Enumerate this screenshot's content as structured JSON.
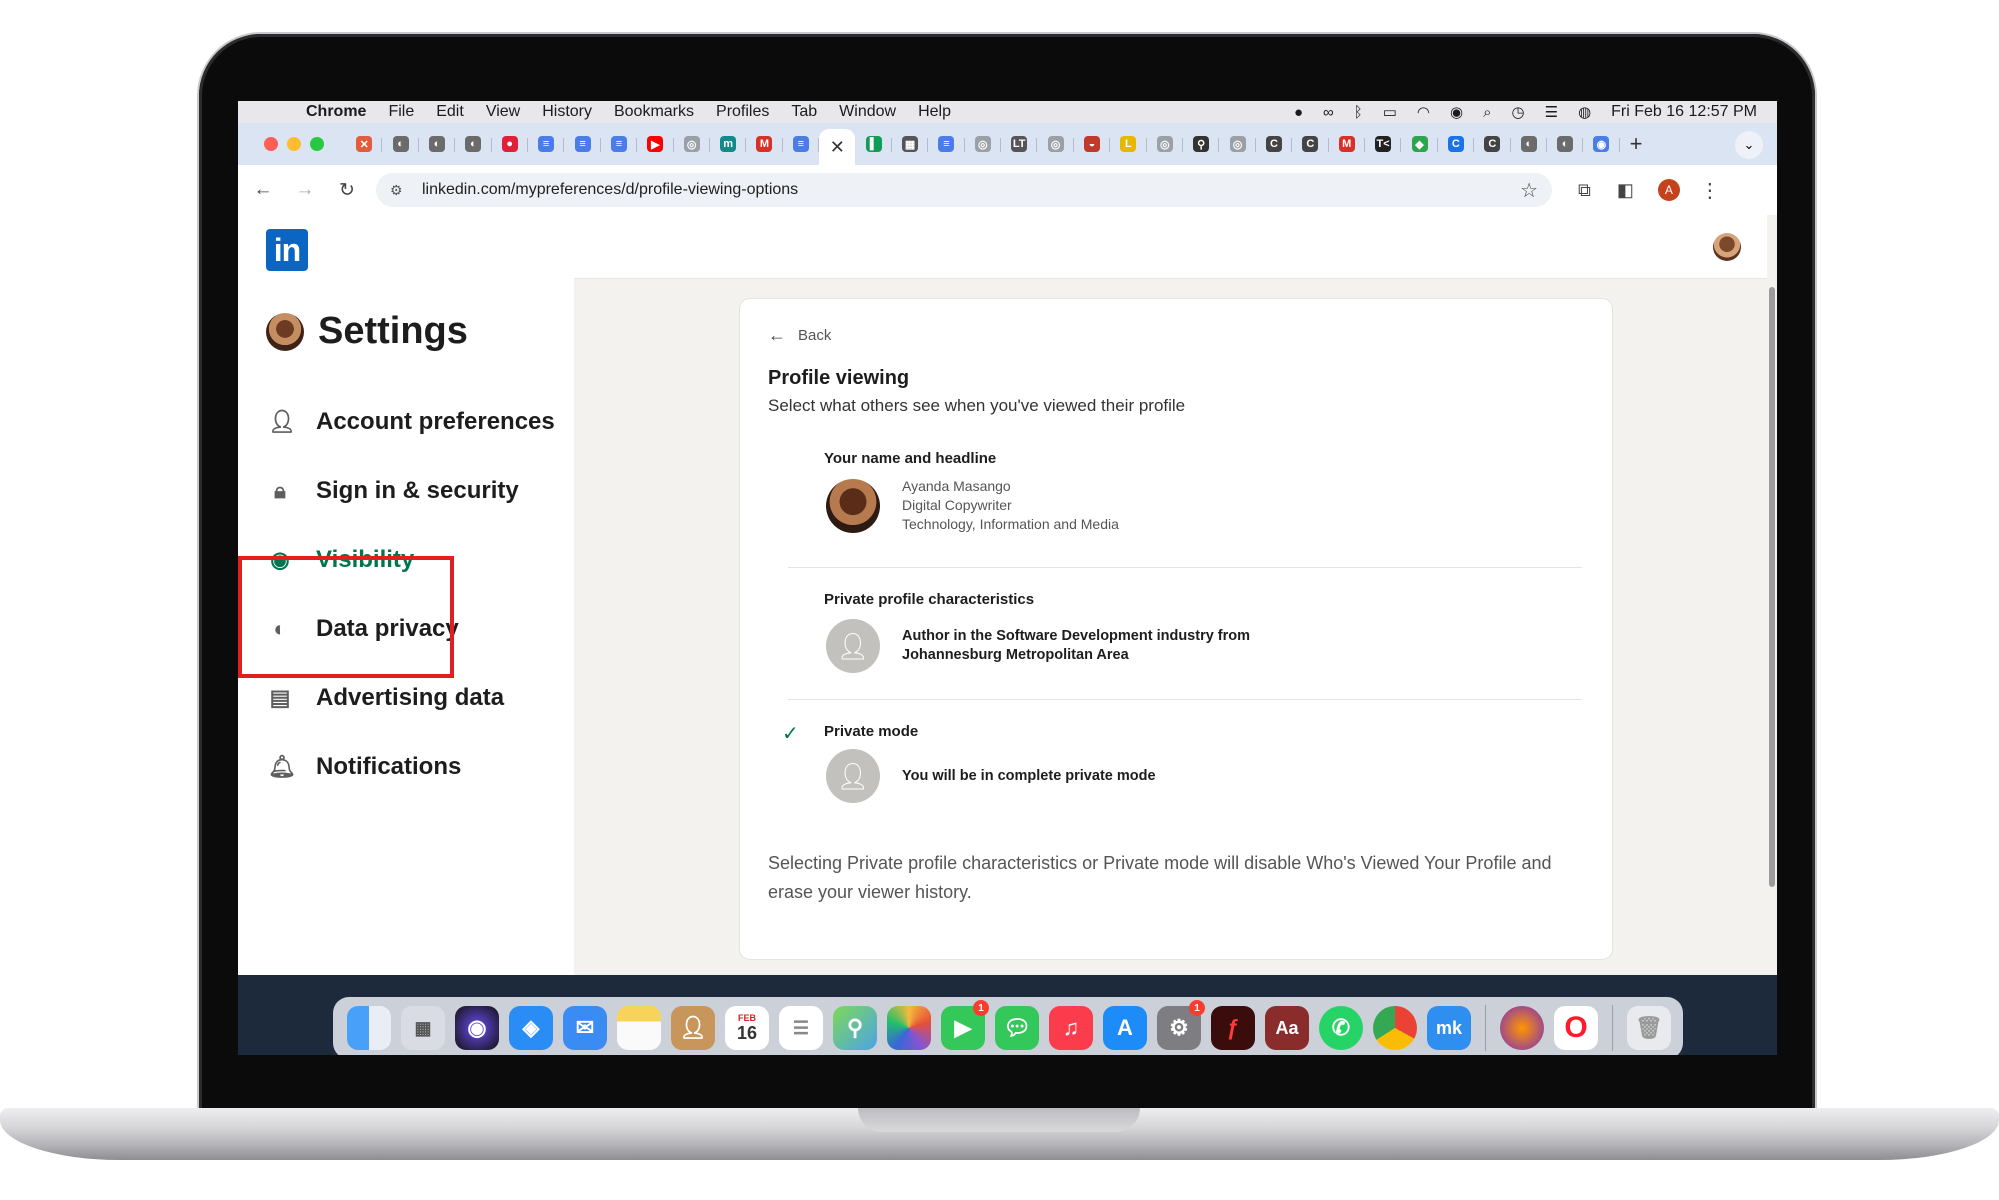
{
  "menubar": {
    "items": [
      "Chrome",
      "File",
      "Edit",
      "View",
      "History",
      "Bookmarks",
      "Profiles",
      "Tab",
      "Window",
      "Help"
    ],
    "clock": "Fri Feb 16  12:57 PM"
  },
  "browser": {
    "url": "linkedin.com/mypreferences/d/profile-viewing-options",
    "profile_initial": "A",
    "tab_favicons": [
      {
        "color": "#e05c3c",
        "glyph": "✕"
      },
      {
        "color": "#6b6b6b",
        "glyph": "◐"
      },
      {
        "color": "#6b6b6b",
        "glyph": "◐"
      },
      {
        "color": "#6b6b6b",
        "glyph": "◐"
      },
      {
        "color": "#e0203a",
        "glyph": "●"
      },
      {
        "color": "#4a7de8",
        "glyph": "≡"
      },
      {
        "color": "#4a7de8",
        "glyph": "≡"
      },
      {
        "color": "#4a7de8",
        "glyph": "≡"
      },
      {
        "color": "#ff0000",
        "glyph": "▶"
      },
      {
        "color": "#9aa0a6",
        "glyph": "◎"
      },
      {
        "color": "#138a8a",
        "glyph": "m"
      },
      {
        "color": "#d93025",
        "glyph": "M"
      },
      {
        "color": "#4a7de8",
        "glyph": "≡"
      }
    ],
    "tab_favicons_after": [
      {
        "color": "#0f9d58",
        "glyph": "▌"
      },
      {
        "color": "#555555",
        "glyph": "▦"
      },
      {
        "color": "#4a7de8",
        "glyph": "≡"
      },
      {
        "color": "#9aa0a6",
        "glyph": "◎"
      },
      {
        "color": "#555555",
        "glyph": "LT"
      },
      {
        "color": "#9aa0a6",
        "glyph": "◎"
      },
      {
        "color": "#c0392b",
        "glyph": "◒"
      },
      {
        "color": "#e6b800",
        "glyph": "L"
      },
      {
        "color": "#9aa0a6",
        "glyph": "◎"
      },
      {
        "color": "#333333",
        "glyph": "⚲"
      },
      {
        "color": "#9aa0a6",
        "glyph": "◎"
      },
      {
        "color": "#444444",
        "glyph": "C"
      },
      {
        "color": "#444444",
        "glyph": "C"
      },
      {
        "color": "#d93025",
        "glyph": "M"
      },
      {
        "color": "#222222",
        "glyph": "T<"
      },
      {
        "color": "#2ea44f",
        "glyph": "◆"
      },
      {
        "color": "#1a73e8",
        "glyph": "C"
      },
      {
        "color": "#444444",
        "glyph": "C"
      },
      {
        "color": "#6b6b6b",
        "glyph": "◐"
      },
      {
        "color": "#6b6b6b",
        "glyph": "◐"
      },
      {
        "color": "#4a7de8",
        "glyph": "◉"
      }
    ]
  },
  "settings": {
    "title": "Settings",
    "nav": [
      {
        "label": "Account preferences",
        "icon": "person-icon"
      },
      {
        "label": "Sign in & security",
        "icon": "lock-icon"
      },
      {
        "label": "Visibility",
        "icon": "eye-icon"
      },
      {
        "label": "Data privacy",
        "icon": "shield-icon"
      },
      {
        "label": "Advertising data",
        "icon": "ad-card-icon"
      },
      {
        "label": "Notifications",
        "icon": "bell-icon"
      }
    ],
    "active": "Visibility"
  },
  "card": {
    "back": "Back",
    "title": "Profile viewing",
    "subtitle": "Select what others see when you've viewed their profile",
    "options": [
      {
        "label": "Your name and headline",
        "lines": [
          "Ayanda Masango",
          "Digital Copywriter",
          "Technology, Information and Media"
        ],
        "selected": false
      },
      {
        "label": "Private profile characteristics",
        "lines": [
          "Author in the Software Development industry from",
          "Johannesburg Metropolitan Area"
        ],
        "selected": false
      },
      {
        "label": "Private mode",
        "lines": [
          "You will be in complete private mode"
        ],
        "selected": true
      }
    ],
    "footnote": "Selecting Private profile characteristics or Private mode will disable Who's Viewed Your Profile and erase your viewer history."
  },
  "dock": {
    "calendar_month": "FEB",
    "calendar_day": "16",
    "facetime_badge": "1",
    "settings_badge": "1"
  }
}
